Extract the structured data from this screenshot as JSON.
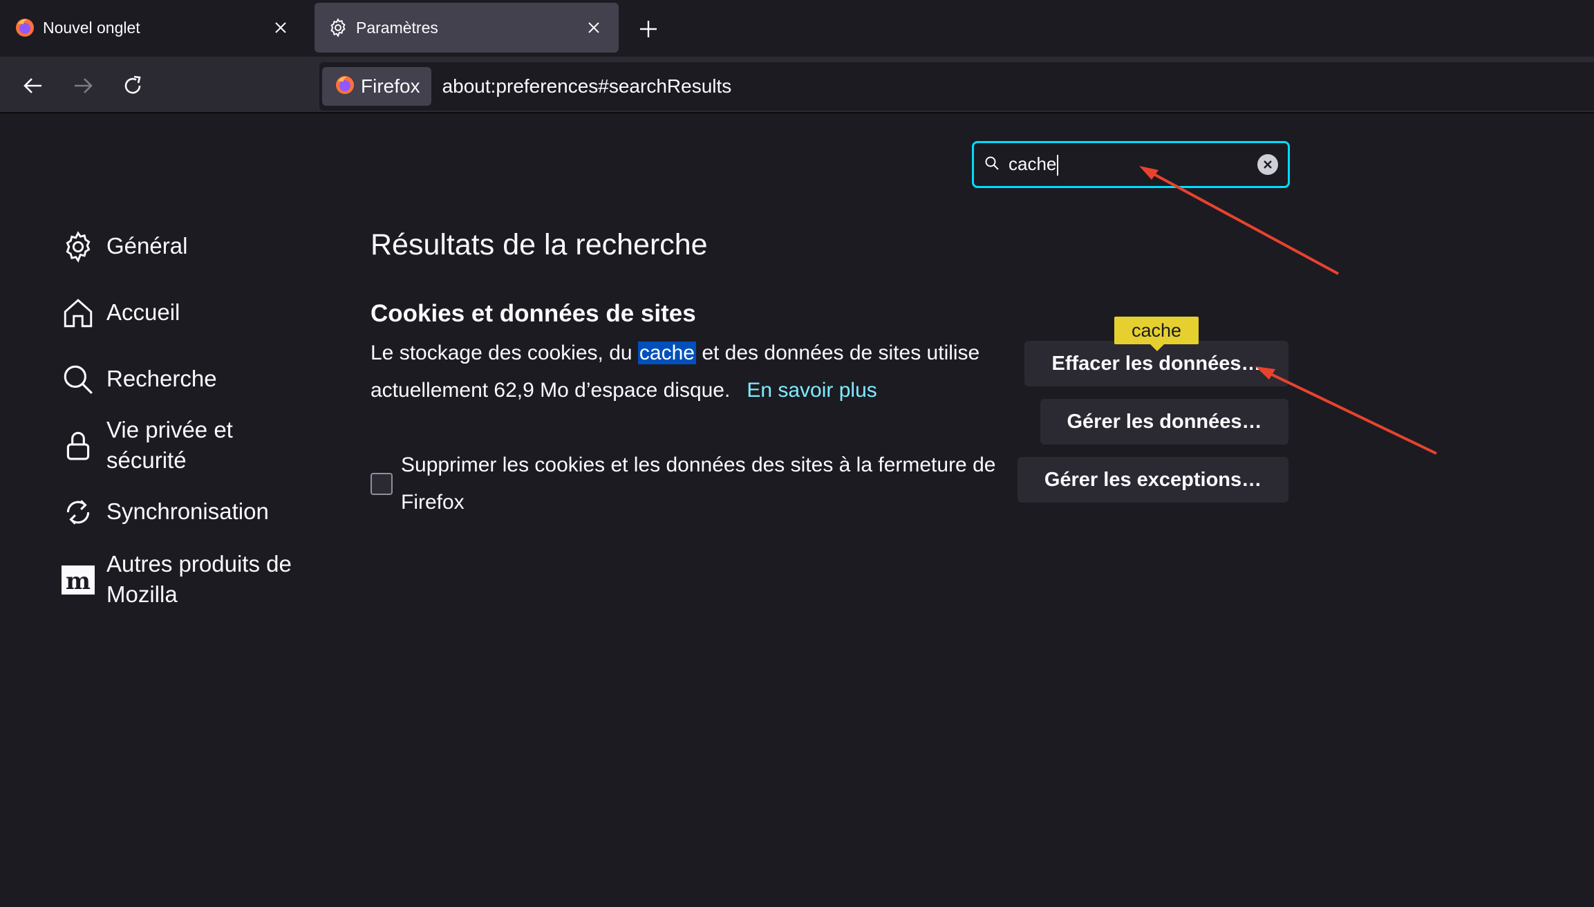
{
  "tabs": [
    {
      "title": "Nouvel onglet",
      "icon": "firefox-logo-icon",
      "active": false
    },
    {
      "title": "Paramètres",
      "icon": "gear-icon",
      "active": true
    }
  ],
  "navbar": {
    "identity_label": "Firefox",
    "url": "about:preferences#searchResults"
  },
  "search": {
    "value": "cache"
  },
  "sidebar": {
    "items": [
      {
        "label": "Général",
        "icon": "gear-icon"
      },
      {
        "label": "Accueil",
        "icon": "home-icon"
      },
      {
        "label": "Recherche",
        "icon": "search-icon"
      },
      {
        "label": "Vie privée et sécurité",
        "icon": "lock-icon"
      },
      {
        "label": "Synchronisation",
        "icon": "sync-icon"
      },
      {
        "label": "Autres produits de Mozilla",
        "icon": "mozilla-icon"
      }
    ]
  },
  "main": {
    "title": "Résultats de la recherche",
    "section_title": "Cookies et données de sites",
    "desc_before": "Le stockage des cookies, du ",
    "desc_highlight": "cache",
    "desc_after": " et des données de sites utilise actuellement 62,9 Mo d’espace disque.",
    "learn_more": "En savoir plus",
    "checkbox_label": "Supprimer les cookies et les données des sites à la fermeture de Firefox",
    "checkbox_checked": false,
    "buttons": {
      "clear": "Effacer les données…",
      "manage": "Gérer les données…",
      "exceptions": "Gérer les exceptions…"
    },
    "tooltip": "cache"
  },
  "colors": {
    "background": "#1c1b22",
    "accent_focus": "#00ddff",
    "link": "#80ebff",
    "highlight": "#0250bb",
    "tooltip": "#e6d030",
    "annotation_arrow": "#e8432e"
  }
}
